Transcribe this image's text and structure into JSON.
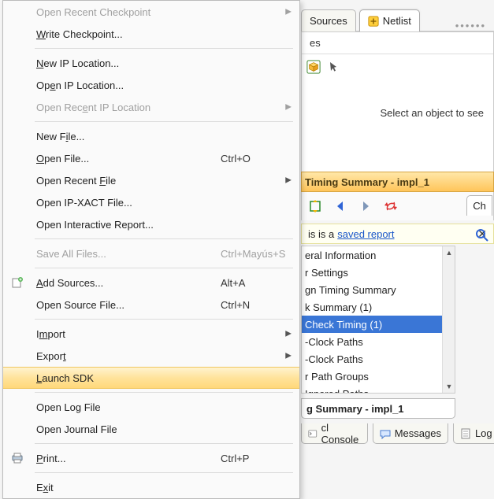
{
  "tabs": {
    "sources": "Sources",
    "netlist": "Netlist"
  },
  "properties": {
    "title_fragment": "es",
    "select_prompt": "Select an object to see"
  },
  "design_run": {
    "header": "Timing Summary - impl_1",
    "footer": "g Summary - impl_1"
  },
  "chk_tab": "Ch",
  "saved_strip": {
    "prefix": "is is a ",
    "link": "saved report"
  },
  "tree_items": [
    "eral Information",
    "r Settings",
    "gn Timing Summary",
    "k Summary (1)",
    "Check Timing (1)",
    "-Clock Paths",
    "-Clock Paths",
    "r Path Groups",
    "Ignored Paths"
  ],
  "bottom_tabs": {
    "console": "cl Console",
    "messages": "Messages",
    "log": "Log"
  },
  "menu": {
    "open_recent_ckpt": "Open Recent Checkpoint",
    "write_ckpt": "Write Checkpoint...",
    "new_ip_loc": "New IP Location...",
    "open_ip_loc": "Open IP Location...",
    "open_recent_ip_loc": "Open Recent IP Location",
    "new_file": "New File...",
    "open_file": "Open File...",
    "open_file_accel": "Ctrl+O",
    "open_recent_file": "Open Recent File",
    "open_ipxact": "Open IP-XACT File...",
    "open_interactive": "Open Interactive Report...",
    "save_all": "Save All Files...",
    "save_all_accel": "Ctrl+Mayús+S",
    "add_sources": "Add Sources...",
    "add_sources_accel": "Alt+A",
    "open_source": "Open Source File...",
    "open_source_accel": "Ctrl+N",
    "import": "Import",
    "export": "Export",
    "launch_sdk": "Launch SDK",
    "open_log": "Open Log File",
    "open_journal": "Open Journal File",
    "print": "Print...",
    "print_accel": "Ctrl+P",
    "exit": "Exit"
  }
}
